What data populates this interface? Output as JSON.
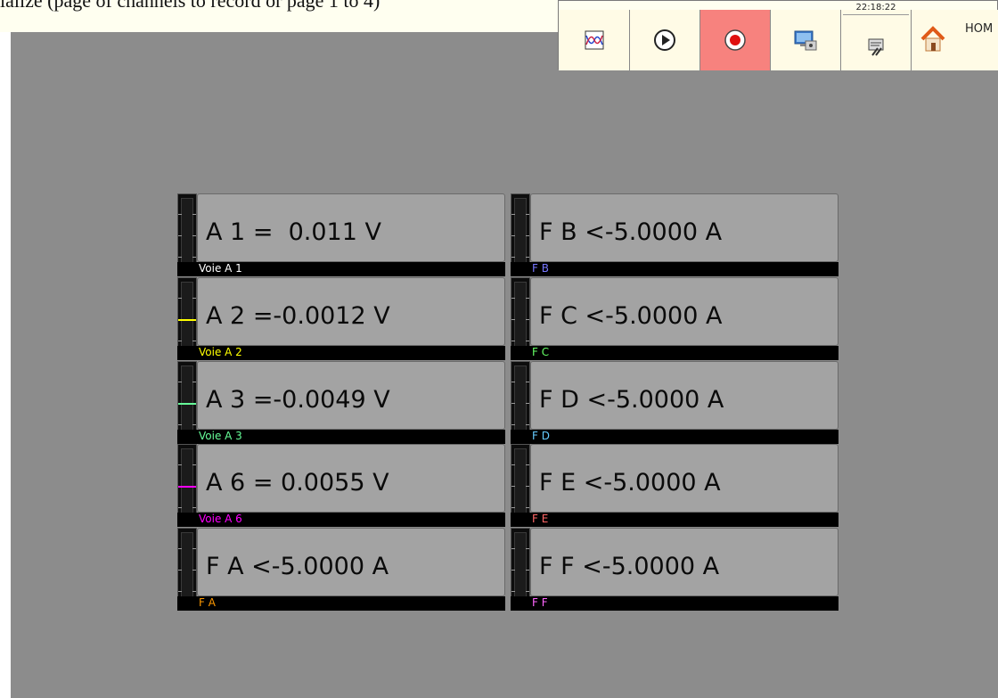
{
  "caption": "ialize (page of channels to record or page 1 to 4)",
  "toolbar": {
    "clock": "22:18:22",
    "home_label": "HOM"
  },
  "colors": {
    "screen_bg": "#8c8c8c",
    "record_button": "#f7827e"
  },
  "channels": [
    {
      "value": "A 1 =  0.011 V",
      "label": "Voie A 1",
      "color": "#ffffff",
      "level": null
    },
    {
      "value": "A 2 =-0.0012 V",
      "label": "Voie A 2",
      "color": "#ffff00",
      "level": 0.5
    },
    {
      "value": "A 3 =-0.0049 V",
      "label": "Voie A 3",
      "color": "#66ff99",
      "level": 0.5
    },
    {
      "value": "A 6 = 0.0055 V",
      "label": "Voie A 6",
      "color": "#ff00ff",
      "level": 0.5
    },
    {
      "value": "F A <-5.0000 A",
      "label": "F A",
      "color": "#ff9900",
      "level": null
    },
    {
      "value": "F B <-5.0000 A",
      "label": "F B",
      "color": "#7777ff",
      "level": null
    },
    {
      "value": "F C <-5.0000 A",
      "label": "F C",
      "color": "#66ff66",
      "level": null
    },
    {
      "value": "F D <-5.0000 A",
      "label": "F D",
      "color": "#66ccff",
      "level": null
    },
    {
      "value": "F E <-5.0000 A",
      "label": "F E",
      "color": "#ff6666",
      "level": null
    },
    {
      "value": "F F <-5.0000 A",
      "label": "F F",
      "color": "#ff66ff",
      "level": null
    }
  ]
}
